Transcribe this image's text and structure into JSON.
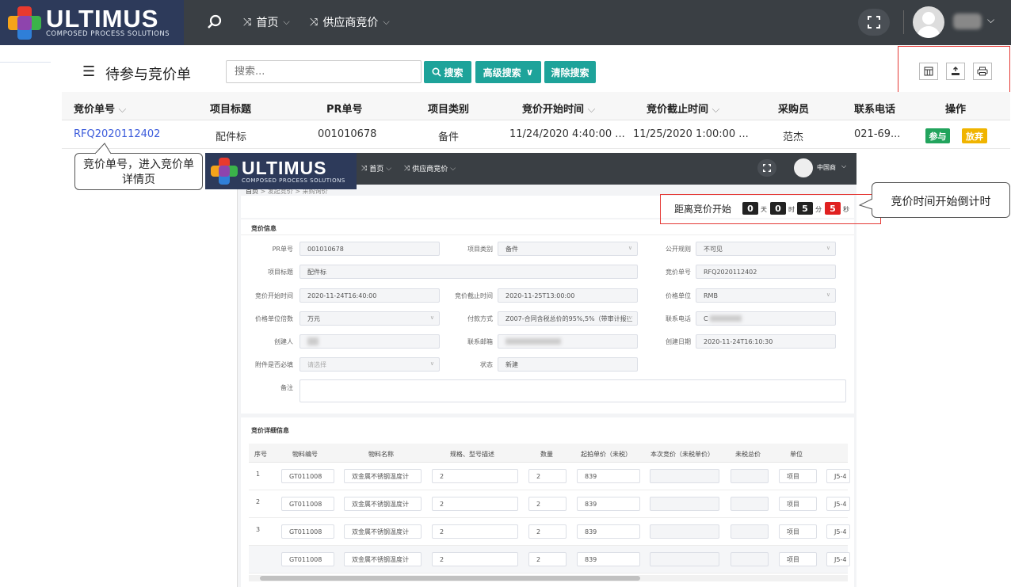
{
  "app": {
    "brand": "ULTIMUS",
    "tagline": "COMPOSED PROCESS SOLUTIONS",
    "nav": [
      {
        "label": "首页",
        "icon": "shuffle-icon"
      },
      {
        "label": "供应商竞价",
        "icon": "shuffle-icon"
      }
    ]
  },
  "list": {
    "title": "待参与竞价单",
    "search_placeholder": "搜索...",
    "search_btn": "搜索",
    "adv_search_btn": "高级搜索",
    "clear_btn": "清除搜索",
    "columns": [
      "竞价单号",
      "项目标题",
      "PR单号",
      "项目类别",
      "竞价开始时间",
      "竞价截止时间",
      "采购员",
      "联系电话",
      "操作"
    ],
    "rows": [
      {
        "rfq": "RFQ2020112402",
        "title": "配件标",
        "pr": "001010678",
        "category": "备件",
        "start": "11/24/2020 4:40:00 ...",
        "end": "11/25/2020 1:00:00 ...",
        "buyer": "范杰",
        "phone": "021-69...",
        "join": "参与",
        "give_up": "放弃"
      }
    ]
  },
  "callouts": {
    "left": "竞价单号，进入竞价单详情页",
    "right": "竞价时间开始倒计时"
  },
  "detail": {
    "nav": [
      {
        "label": "首页"
      },
      {
        "label": "供应商竞价"
      }
    ],
    "user": "中国商",
    "breadcrumb": [
      "首页",
      "发起竞价",
      "采购询价"
    ],
    "countdown": {
      "label": "距离竞价开始",
      "days": "0",
      "days_unit": "天",
      "hours": "0",
      "hours_unit": "时",
      "minutes": "5",
      "minutes_unit": "分",
      "seconds": "5",
      "seconds_unit": "秒"
    },
    "info_title": "竞价信息",
    "fields": {
      "pr_label": "PR单号",
      "pr": "001010678",
      "cat_label": "项目类别",
      "cat": "备件",
      "pub_label": "公开规则",
      "pub": "不可见",
      "title_label": "项目标题",
      "title": "配件标",
      "rfq_label": "竞价单号",
      "rfq": "RFQ2020112402",
      "start_label": "竞价开始时间",
      "start": "2020-11-24T16:40:00",
      "end_label": "竞价截止时间",
      "end": "2020-11-25T13:00:00",
      "unit_label": "价格单位",
      "unit": "RMB",
      "mult_label": "价格单位倍数",
      "mult": "万元",
      "pay_label": "付款方式",
      "pay": "Z007-合同含税总价的95%,5%（带审计报查",
      "tel_label": "联系电话",
      "tel": "C",
      "creator_label": "创建人",
      "email_label": "联系邮箱",
      "cdate_label": "创建日期",
      "cdate": "2020-11-24T16:10:30",
      "att_label": "附件是否必填",
      "att_placeholder": "请选择",
      "status_label": "状态",
      "status": "新建",
      "remark_label": "备注"
    },
    "grid_title": "竞价详细信息",
    "grid_cols": [
      "序号",
      "物料编号",
      "物料名称",
      "规格、型号描述",
      "数量",
      "起拍单价（未税）",
      "本次竞价（未税单价）",
      "未税总价",
      "单位"
    ],
    "grid_rows": [
      {
        "no": "1",
        "code": "GT011008",
        "name": "双金属不锈钢温度计",
        "spec": "2",
        "qty": "2",
        "price": "839",
        "unit": "项目",
        "extra": "J5-4"
      },
      {
        "no": "2",
        "code": "GT011008",
        "name": "双金属不锈钢温度计",
        "spec": "2",
        "qty": "2",
        "price": "839",
        "unit": "项目",
        "extra": "J5-4"
      },
      {
        "no": "3",
        "code": "GT011008",
        "name": "双金属不锈钢温度计",
        "spec": "2",
        "qty": "2",
        "price": "839",
        "unit": "项目",
        "extra": "J5-4"
      },
      {
        "no": "",
        "code": "GT011008",
        "name": "双金属不锈钢温度计",
        "spec": "2",
        "qty": "2",
        "price": "839",
        "unit": "项目",
        "extra": "J5-4"
      }
    ]
  },
  "colors": {
    "nav": "#3a3f44",
    "logo_bg": "#2d3a5a",
    "teal": "#1ea39a",
    "green": "#22a45d",
    "yellow": "#f0b400",
    "red": "#e02020",
    "link": "#3b5bdb"
  }
}
